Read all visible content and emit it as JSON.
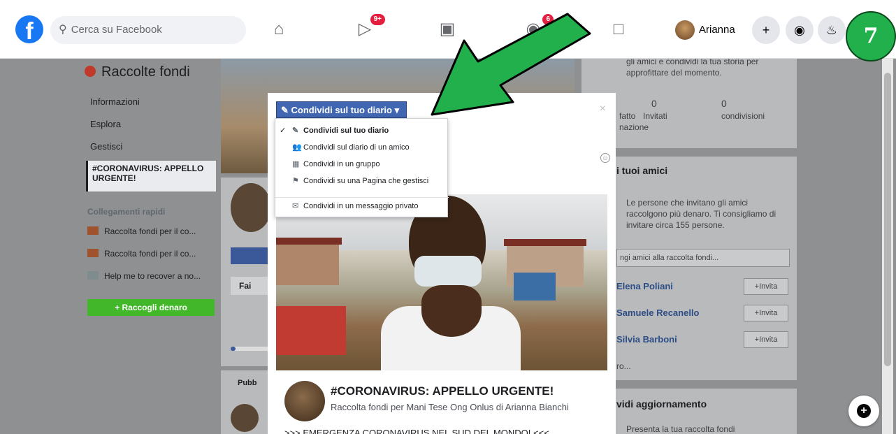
{
  "topbar": {
    "logo": "f",
    "search_placeholder": "Cerca su Facebook",
    "video_badge": "9+",
    "groups_badge": "6",
    "user_name": "Arianna",
    "plus": "+",
    "step_number": "7"
  },
  "left": {
    "title": "Raccolte fondi",
    "items": [
      "Informazioni",
      "Esplora",
      "Gestisci"
    ],
    "selected": "#CORONAVIRUS: APPELLO URGENTE!",
    "quick_links_title": "Collegamenti rapidi",
    "quick_links": [
      "Raccolta fondi per il co...",
      "Raccolta fondi per il co...",
      "Help me to recover a no..."
    ],
    "raise_button": "+ Raccogli denaro"
  },
  "middle": {
    "partial_button": "Fai",
    "publish": "Pubb"
  },
  "right": {
    "story_text": "gli amici e condividi la tua storia per approfittare del momento.",
    "stats": [
      {
        "value": "0",
        "label": "Invitati"
      },
      {
        "value": "0",
        "label": "condivisioni"
      }
    ],
    "stat_partial_1": "fatto",
    "stat_partial_2": "nazione",
    "friends_title": "i tuoi amici",
    "friends_text": "Le persone che invitano gli amici raccolgono più denaro. Ti consigliamo di invitare circa 155 persone.",
    "add_friends_placeholder": "ngi amici alla raccolta fondi...",
    "friends": [
      {
        "name": "Elena Poliani",
        "action": "Invita"
      },
      {
        "name": "Samuele Recanello",
        "action": "Invita"
      },
      {
        "name": "Silvia Barboni",
        "action": "Invita"
      }
    ],
    "more": "ro...",
    "update_title": "vidi aggiornamento",
    "update_text": "Presenta la tua raccolta fondi"
  },
  "modal": {
    "share_button": "Condividi sul tuo diario",
    "close": "×",
    "dropdown": [
      {
        "icon": "✎",
        "label": "Condividi sul tuo diario"
      },
      {
        "icon": "👥",
        "label": "Condividi sul diario di un amico"
      },
      {
        "icon": "▦",
        "label": "Condividi in un gruppo"
      },
      {
        "icon": "⚑",
        "label": "Condividi su una Pagina che gestisci"
      },
      {
        "icon": "✉",
        "label": "Condividi in un messaggio privato"
      }
    ],
    "post_title": "#CORONAVIRUS: APPELLO URGENTE!",
    "post_subtitle": "Raccolta fondi per Mani Tese Ong Onlus di Arianna Bianchi",
    "post_body": ">>> EMERGENZA CORONAVIRUS NEL SUD DEL MONDO! <<<"
  },
  "colors": {
    "facebook_blue": "#1877f2",
    "share_blue": "#4267b2",
    "arrow_green": "#21b04b",
    "badge_red": "#e41e3f"
  }
}
